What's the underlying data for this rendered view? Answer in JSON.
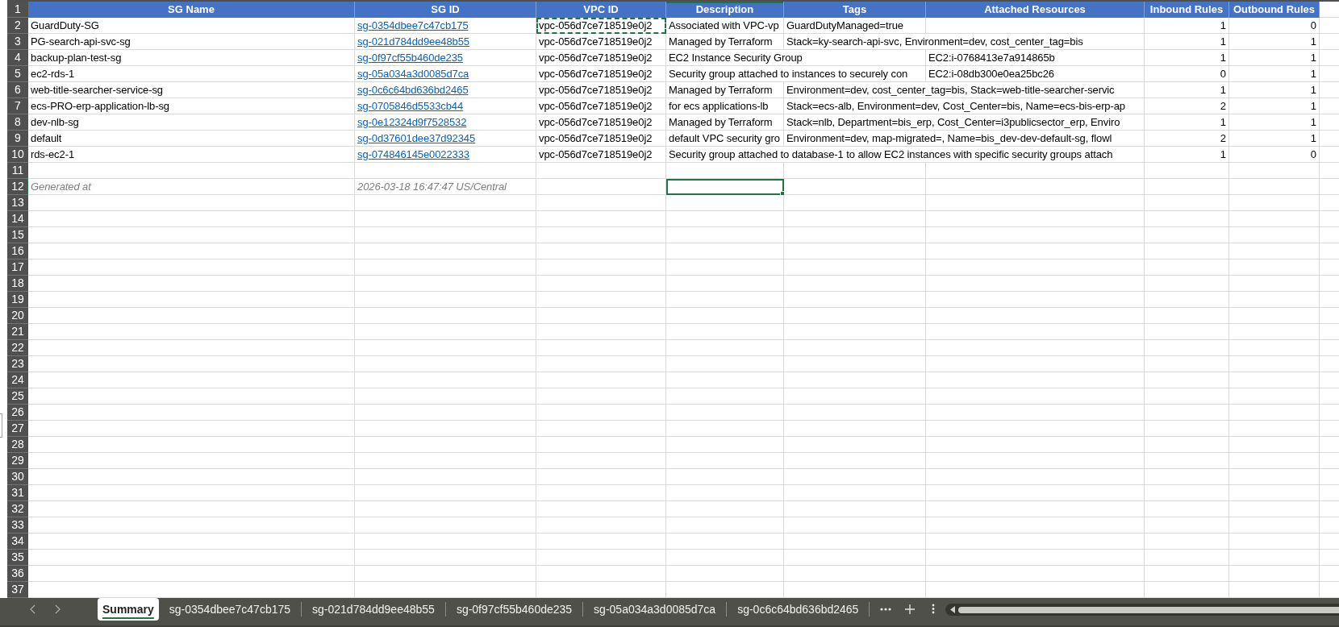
{
  "sheet": {
    "header": {
      "number": "1",
      "selected": false,
      "columns": [
        {
          "label": "SG Name",
          "selected": false
        },
        {
          "label": "SG ID",
          "selected": false
        },
        {
          "label": "VPC ID",
          "selected": false
        },
        {
          "label": "Description",
          "selected": true
        },
        {
          "label": "Tags",
          "selected": false
        },
        {
          "label": "Attached Resources",
          "selected": false
        },
        {
          "label": "Inbound Rules",
          "selected": false
        },
        {
          "label": "Outbound Rules",
          "selected": false
        }
      ]
    },
    "rows": [
      {
        "number": "2",
        "selected": false,
        "cells": [
          {
            "text": "GuardDuty-SG",
            "kind": "text",
            "selected": false,
            "copied": false
          },
          {
            "text": "sg-0354dbee7c47cb175",
            "kind": "link",
            "selected": false,
            "copied": false
          },
          {
            "text": "vpc-056d7ce718519e0j2",
            "kind": "text",
            "selected": false,
            "copied": true
          },
          {
            "text": "Associated with VPC-vp",
            "kind": "text",
            "selected": false,
            "copied": false
          },
          {
            "text": "GuardDutyManaged=true",
            "kind": "text",
            "selected": false,
            "copied": false
          },
          null,
          {
            "text": "1",
            "kind": "number",
            "selected": false,
            "copied": false
          },
          {
            "text": "0",
            "kind": "number",
            "selected": false,
            "copied": false
          }
        ]
      },
      {
        "number": "3",
        "selected": false,
        "cells": [
          {
            "text": "PG-search-api-svc-sg",
            "kind": "text",
            "selected": false,
            "copied": false
          },
          {
            "text": "sg-021d784dd9ee48b55",
            "kind": "link",
            "selected": false,
            "copied": false
          },
          {
            "text": "vpc-056d7ce718519e0j2",
            "kind": "text",
            "selected": false,
            "copied": false
          },
          {
            "text": "Managed by Terraform",
            "kind": "text",
            "selected": false,
            "copied": false
          },
          {
            "text": "Stack=ky-search-api-svc, Environment=dev, cost_center_tag=bis",
            "kind": "text",
            "selected": false,
            "copied": false
          },
          null,
          {
            "text": "1",
            "kind": "number",
            "selected": false,
            "copied": false
          },
          {
            "text": "1",
            "kind": "number",
            "selected": false,
            "copied": false
          }
        ]
      },
      {
        "number": "4",
        "selected": false,
        "cells": [
          {
            "text": "backup-plan-test-sg",
            "kind": "text",
            "selected": false,
            "copied": false
          },
          {
            "text": "sg-0f97cf55b460de235",
            "kind": "link",
            "selected": false,
            "copied": false
          },
          {
            "text": "vpc-056d7ce718519e0j2",
            "kind": "text",
            "selected": false,
            "copied": false
          },
          {
            "text": "EC2 Instance Security Group",
            "kind": "text",
            "selected": false,
            "copied": false
          },
          null,
          {
            "text": "EC2:i-0768413e7a914865b",
            "kind": "text",
            "selected": false,
            "copied": false
          },
          {
            "text": "1",
            "kind": "number",
            "selected": false,
            "copied": false
          },
          {
            "text": "1",
            "kind": "number",
            "selected": false,
            "copied": false
          }
        ]
      },
      {
        "number": "5",
        "selected": false,
        "cells": [
          {
            "text": "ec2-rds-1",
            "kind": "text",
            "selected": false,
            "copied": false
          },
          {
            "text": "sg-05a034a3d0085d7ca",
            "kind": "link",
            "selected": false,
            "copied": false
          },
          {
            "text": "vpc-056d7ce718519e0j2",
            "kind": "text",
            "selected": false,
            "copied": false
          },
          {
            "text": "Security group attached to instances to securely con",
            "kind": "text",
            "selected": false,
            "copied": false
          },
          null,
          {
            "text": "EC2:i-08db300e0ea25bc26",
            "kind": "text",
            "selected": false,
            "copied": false
          },
          {
            "text": "0",
            "kind": "number",
            "selected": false,
            "copied": false
          },
          {
            "text": "1",
            "kind": "number",
            "selected": false,
            "copied": false
          }
        ]
      },
      {
        "number": "6",
        "selected": false,
        "cells": [
          {
            "text": "web-title-searcher-service-sg",
            "kind": "text",
            "selected": false,
            "copied": false
          },
          {
            "text": "sg-0c6c64bd636bd2465",
            "kind": "link",
            "selected": false,
            "copied": false
          },
          {
            "text": "vpc-056d7ce718519e0j2",
            "kind": "text",
            "selected": false,
            "copied": false
          },
          {
            "text": "Managed by Terraform",
            "kind": "text",
            "selected": false,
            "copied": false
          },
          {
            "text": "Environment=dev, cost_center_tag=bis, Stack=web-title-searcher-servic",
            "kind": "text",
            "selected": false,
            "copied": false
          },
          null,
          {
            "text": "1",
            "kind": "number",
            "selected": false,
            "copied": false
          },
          {
            "text": "1",
            "kind": "number",
            "selected": false,
            "copied": false
          }
        ]
      },
      {
        "number": "7",
        "selected": false,
        "cells": [
          {
            "text": "ecs-PRO-erp-application-lb-sg",
            "kind": "text",
            "selected": false,
            "copied": false
          },
          {
            "text": "sg-0705846d5533cb44",
            "kind": "link",
            "selected": false,
            "copied": false
          },
          {
            "text": "vpc-056d7ce718519e0j2",
            "kind": "text",
            "selected": false,
            "copied": false
          },
          {
            "text": "for ecs applications-lb",
            "kind": "text",
            "selected": false,
            "copied": false
          },
          {
            "text": "Stack=ecs-alb, Environment=dev, Cost_Center=bis, Name=ecs-bis-erp-ap",
            "kind": "text",
            "selected": false,
            "copied": false
          },
          null,
          {
            "text": "2",
            "kind": "number",
            "selected": false,
            "copied": false
          },
          {
            "text": "1",
            "kind": "number",
            "selected": false,
            "copied": false
          }
        ]
      },
      {
        "number": "8",
        "selected": false,
        "cells": [
          {
            "text": "dev-nlb-sg",
            "kind": "text",
            "selected": false,
            "copied": false
          },
          {
            "text": "sg-0e12324d9f7528532",
            "kind": "link",
            "selected": false,
            "copied": false
          },
          {
            "text": "vpc-056d7ce718519e0j2",
            "kind": "text",
            "selected": false,
            "copied": false
          },
          {
            "text": "Managed by Terraform",
            "kind": "text",
            "selected": false,
            "copied": false
          },
          {
            "text": "Stack=nlb, Department=bis_erp, Cost_Center=i3publicsector_erp, Enviro",
            "kind": "text",
            "selected": false,
            "copied": false
          },
          null,
          {
            "text": "1",
            "kind": "number",
            "selected": false,
            "copied": false
          },
          {
            "text": "1",
            "kind": "number",
            "selected": false,
            "copied": false
          }
        ]
      },
      {
        "number": "9",
        "selected": false,
        "cells": [
          {
            "text": "default",
            "kind": "text",
            "selected": false,
            "copied": false
          },
          {
            "text": "sg-0d37601dee37d92345",
            "kind": "link",
            "selected": false,
            "copied": false
          },
          {
            "text": "vpc-056d7ce718519e0j2",
            "kind": "text",
            "selected": false,
            "copied": false
          },
          {
            "text": "default VPC security gro",
            "kind": "text",
            "selected": false,
            "copied": false
          },
          {
            "text": "Environment=dev, map-migrated=, Name=bis_dev-dev-default-sg, flowl",
            "kind": "text",
            "selected": false,
            "copied": false
          },
          null,
          {
            "text": "2",
            "kind": "number",
            "selected": false,
            "copied": false
          },
          {
            "text": "1",
            "kind": "number",
            "selected": false,
            "copied": false
          }
        ]
      },
      {
        "number": "10",
        "selected": false,
        "cells": [
          {
            "text": "rds-ec2-1",
            "kind": "text",
            "selected": false,
            "copied": false
          },
          {
            "text": "sg-074846145e0022333",
            "kind": "link",
            "selected": false,
            "copied": false
          },
          {
            "text": "vpc-056d7ce718519e0j2",
            "kind": "text",
            "selected": false,
            "copied": false
          },
          {
            "text": "Security group attached to database-1 to allow EC2 instances with specific security groups attach",
            "kind": "text",
            "selected": false,
            "copied": false
          },
          null,
          null,
          {
            "text": "1",
            "kind": "number",
            "selected": false,
            "copied": false
          },
          {
            "text": "0",
            "kind": "number",
            "selected": false,
            "copied": false
          }
        ]
      },
      {
        "number": "11",
        "selected": false
      },
      {
        "number": "12",
        "selected": true,
        "cells": [
          {
            "text": "Generated at",
            "kind": "note",
            "selected": false,
            "copied": false
          },
          {
            "text": "2026-03-18 16:47:47 US/Central",
            "kind": "note",
            "selected": false,
            "copied": false
          },
          null,
          {
            "selected": true,
            "copied": false
          }
        ]
      },
      {
        "number": "13",
        "selected": false
      },
      {
        "number": "14",
        "selected": false
      },
      {
        "number": "15",
        "selected": false
      },
      {
        "number": "16",
        "selected": false
      },
      {
        "number": "17",
        "selected": false
      },
      {
        "number": "18",
        "selected": false
      },
      {
        "number": "19",
        "selected": false
      },
      {
        "number": "20",
        "selected": false
      },
      {
        "number": "21",
        "selected": false
      },
      {
        "number": "22",
        "selected": false
      },
      {
        "number": "23",
        "selected": false
      },
      {
        "number": "24",
        "selected": false
      },
      {
        "number": "25",
        "selected": false
      },
      {
        "number": "26",
        "selected": false
      },
      {
        "number": "27",
        "selected": false
      },
      {
        "number": "28",
        "selected": false
      },
      {
        "number": "29",
        "selected": false
      },
      {
        "number": "30",
        "selected": false
      },
      {
        "number": "31",
        "selected": false
      },
      {
        "number": "32",
        "selected": false
      },
      {
        "number": "33",
        "selected": false
      },
      {
        "number": "34",
        "selected": false
      },
      {
        "number": "35",
        "selected": false
      },
      {
        "number": "36",
        "selected": false
      },
      {
        "number": "37",
        "selected": false
      }
    ]
  },
  "sheet_tabs": {
    "tabs": [
      {
        "label": "Summary",
        "selected": true
      },
      {
        "label": "sg-0354dbee7c47cb175",
        "selected": false
      },
      {
        "label": "sg-021d784dd9ee48b55",
        "selected": false
      },
      {
        "label": "sg-0f97cf55b460de235",
        "selected": false
      },
      {
        "label": "sg-05a034a3d0085d7ca",
        "selected": false
      },
      {
        "label": "sg-0c6c64bd636bd2465",
        "selected": false
      }
    ]
  }
}
